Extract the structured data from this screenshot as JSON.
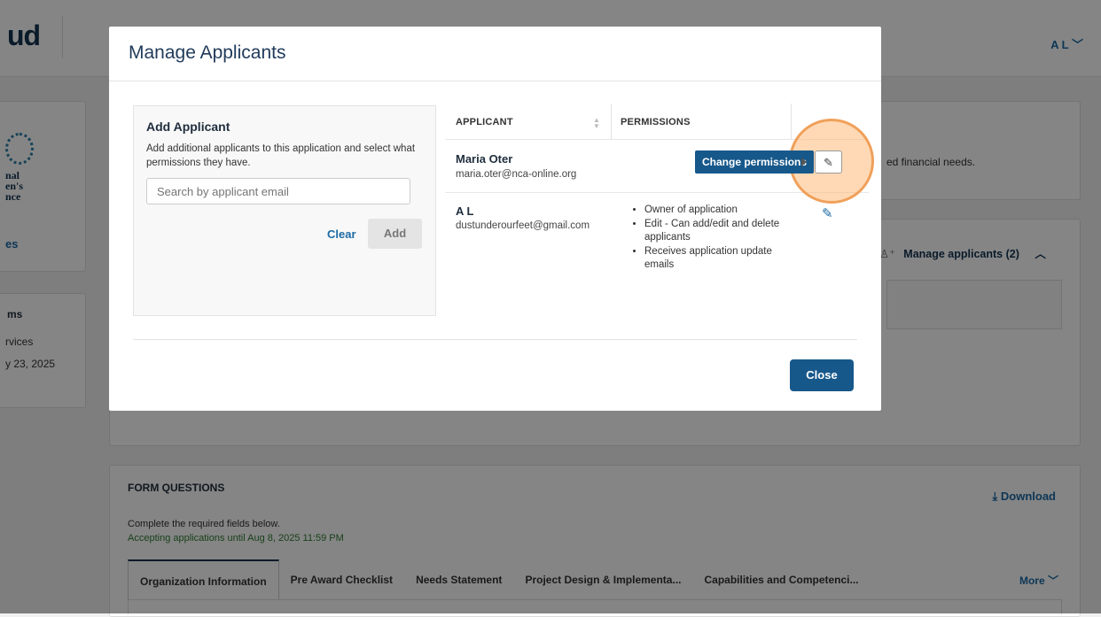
{
  "background": {
    "logo_text": "ud",
    "user_menu": "A L ﹀",
    "org_logo_lines": [
      "nal",
      "en's",
      "nce"
    ],
    "left_link": "es",
    "terms_title": "ms",
    "terms_lines": [
      "rvices",
      "y 23, 2025"
    ],
    "right_info": "ed financial needs.",
    "manage_applicants_link": "Manage applicants (2)",
    "form_questions": {
      "title": "FORM QUESTIONS",
      "download_label": "Download",
      "subtitle": "Complete the required fields below.",
      "deadline": "Accepting applications until Aug 8, 2025 11:59 PM",
      "tabs": [
        "Organization Information",
        "Pre Award Checklist",
        "Needs Statement",
        "Project Design & Implementa...",
        "Capabilities and Competenci..."
      ],
      "more_label": "More"
    }
  },
  "modal": {
    "title": "Manage Applicants",
    "add_panel": {
      "title": "Add Applicant",
      "description": "Add additional applicants to this application and select what permissions they have.",
      "search_placeholder": "Search by applicant email",
      "clear_label": "Clear",
      "add_label": "Add"
    },
    "table": {
      "headers": {
        "applicant": "APPLICANT",
        "permissions": "PERMISSIONS"
      },
      "rows": [
        {
          "name": "Maria Oter",
          "email": "maria.oter@nca-online.org",
          "permissions": []
        },
        {
          "name": "A L",
          "email": "dustunderourfeet@gmail.com",
          "permissions": [
            "Owner of application",
            "Edit - Can add/edit and delete applicants",
            "Receives application update emails"
          ]
        }
      ]
    },
    "tooltip": "Change permissions",
    "close_label": "Close"
  },
  "colors": {
    "primary": "#17588b",
    "link": "#1b6aa5",
    "highlight": "#f0a05a"
  }
}
